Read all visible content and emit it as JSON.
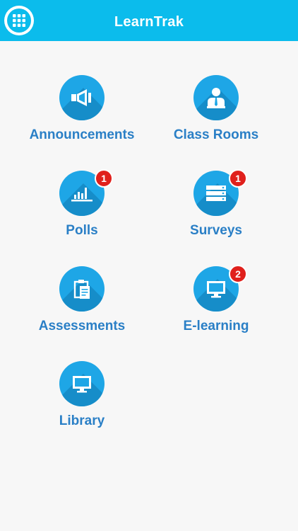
{
  "app": {
    "title": "LearnTrak"
  },
  "colors": {
    "header": "#0bbcec",
    "icon_circle": "#1ea6e6",
    "label": "#2a7fc6",
    "badge": "#e0201c"
  },
  "tiles": [
    {
      "label": "Announcements",
      "icon": "megaphone-icon",
      "badge": ""
    },
    {
      "label": "Class Rooms",
      "icon": "teacher-icon",
      "badge": ""
    },
    {
      "label": "Polls",
      "icon": "bar-chart-icon",
      "badge": "1"
    },
    {
      "label": "Surveys",
      "icon": "list-stack-icon",
      "badge": "1"
    },
    {
      "label": "Assessments",
      "icon": "clipboard-icon",
      "badge": ""
    },
    {
      "label": "E-learning",
      "icon": "monitor-icon",
      "badge": "2"
    },
    {
      "label": "Library",
      "icon": "monitor-icon",
      "badge": ""
    }
  ]
}
